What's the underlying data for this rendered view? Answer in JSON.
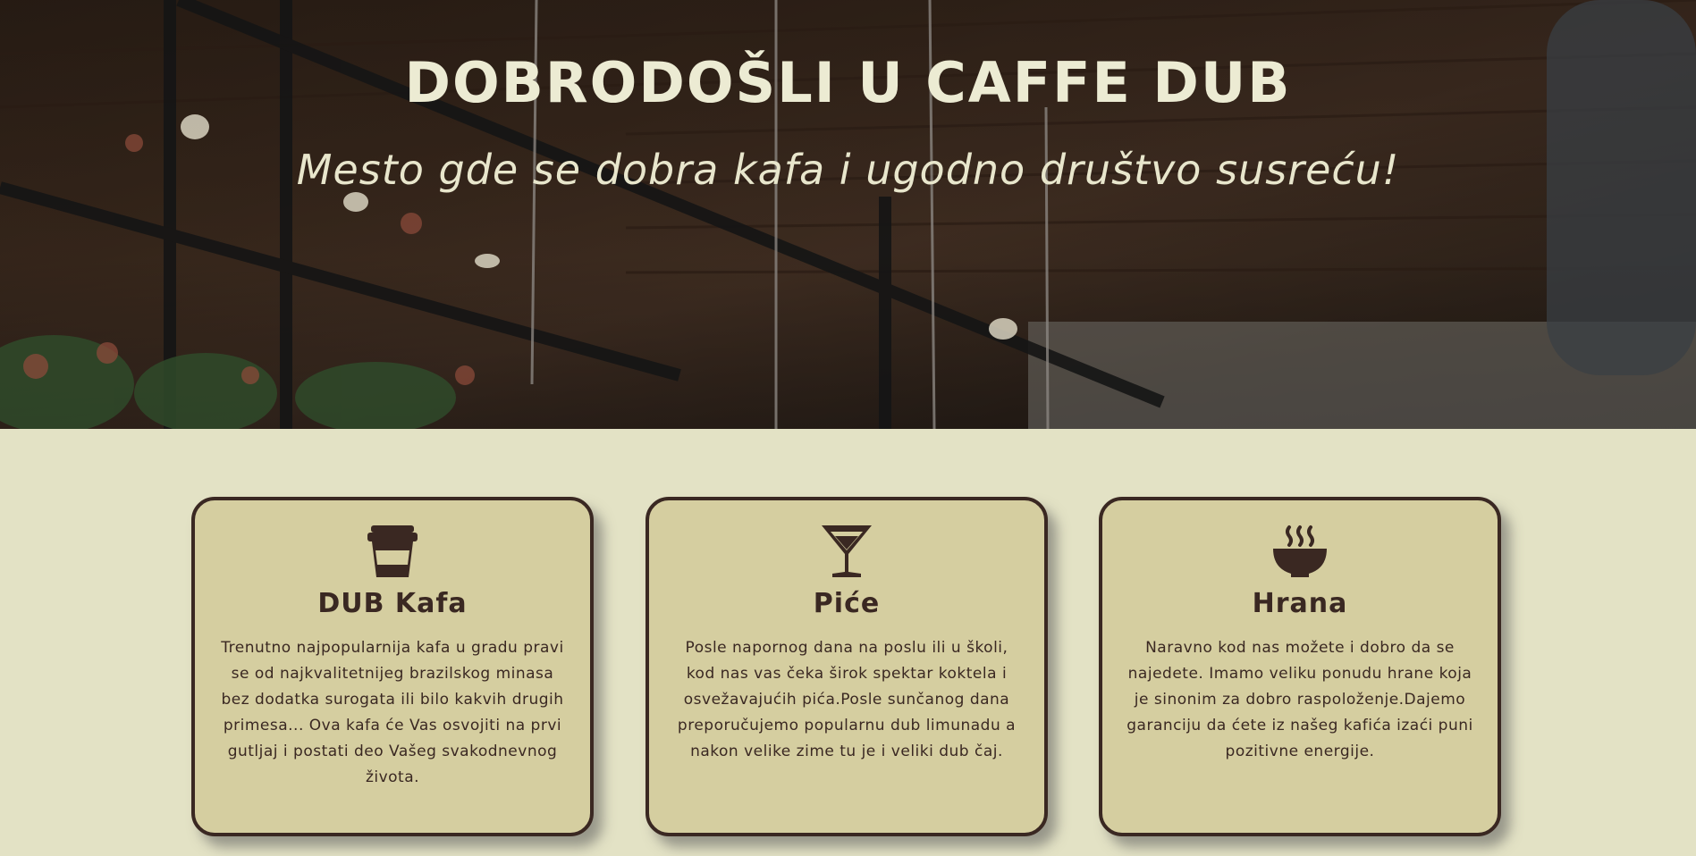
{
  "hero": {
    "title": "DOBRODOŠLI U CAFFE DUB",
    "subtitle": "Mesto gde se dobra kafa i ugodno društvo susreću!"
  },
  "cards": [
    {
      "icon": "coffee-cup-icon",
      "title": "DUB Kafa",
      "text": "Trenutno najpopularnija kafa u gradu pravi se od najkvalitetnijeg brazilskog minasa bez dodatka surogata ili bilo kakvih drugih primesa... Ova kafa će Vas osvojiti na prvi gutljaj i postati deo Vašeg svakodnevnog života."
    },
    {
      "icon": "cocktail-glass-icon",
      "title": "Piće",
      "text": "Posle napornog dana na poslu ili u školi, kod nas vas čeka širok spektar koktela i osvežavajućih pića.Posle sunčanog dana preporučujemo popularnu dub limunadu a nakon velike zime tu je i veliki dub čaj."
    },
    {
      "icon": "hot-bowl-icon",
      "title": "Hrana",
      "text": "Naravno kod nas možete i dobro da se najedete. Imamo veliku ponudu hrane koja je sinonim za dobro raspoloženje.Dajemo garanciju da ćete iz našeg kafića izaći puni pozitivne energije."
    }
  ],
  "colors": {
    "background": "#e3e2c5",
    "card_background": "#d5cea0",
    "card_border": "#3a2822",
    "text_dark": "#3a2822",
    "hero_text": "#ecebd3"
  }
}
